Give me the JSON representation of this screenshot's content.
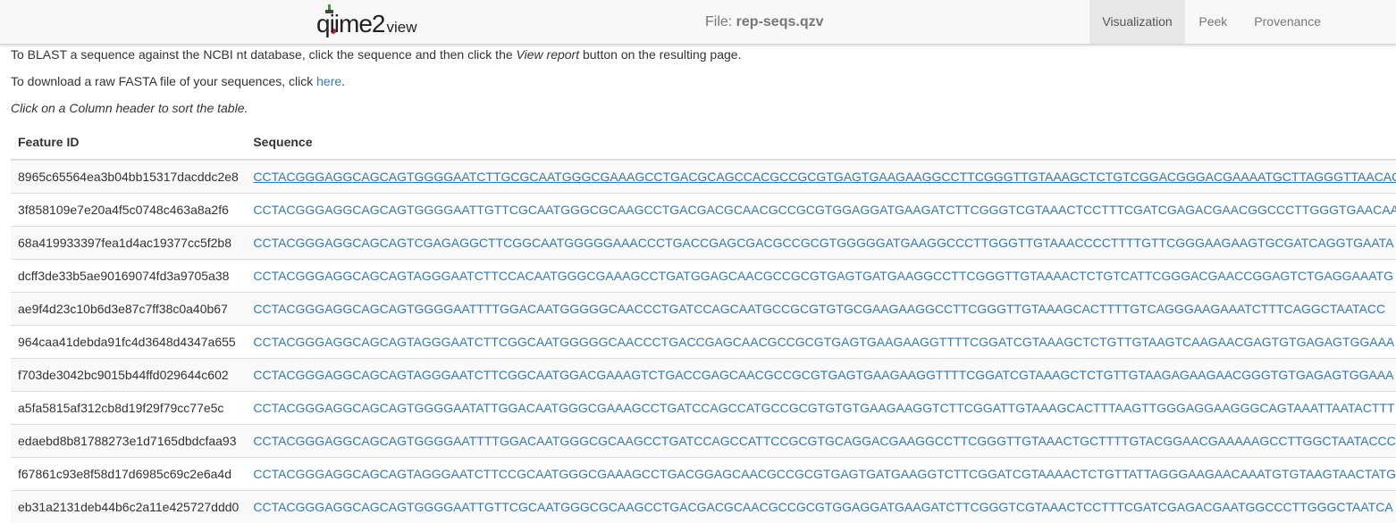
{
  "header": {
    "logo_main": "qiime2",
    "logo_sub": "view",
    "file_prefix": "File: ",
    "file_name": "rep-seqs.qzv",
    "tabs": [
      {
        "label": "Visualization",
        "active": true
      },
      {
        "label": "Peek",
        "active": false
      },
      {
        "label": "Provenance",
        "active": false
      }
    ]
  },
  "intro": {
    "blast_before": "To BLAST a sequence against the NCBI nt database, click the sequence and then click the ",
    "blast_em": "View report",
    "blast_after": " button on the resulting page.",
    "download_before": "To download a raw FASTA file of your sequences, click ",
    "download_link": "here",
    "download_after": ".",
    "sort_hint": "Click on a Column header to sort the table."
  },
  "table": {
    "columns": [
      "Feature ID",
      "Sequence"
    ],
    "rows": [
      {
        "id": "8965c65564ea3b04bb15317dacddc2e8",
        "seq": "CCTACGGGAGGCAGCAGTGGGGAATCTTGCGCAATGGGCGAAAGCCTGACGCAGCCACGCCGCGTGAGTGAAGAAGGCCTTCGGGTTGTAAAGCTCTGTCGGACGGGACGAAAATGCTTAGGGTTAACAC"
      },
      {
        "id": "3f858109e7e20a4f5c0748c463a8a2f6",
        "seq": "CCTACGGGAGGCAGCAGTGGGGAATTGTTCGCAATGGGCGCAAGCCTGACGACGCAACGCCGCGTGGAGGATGAAGATCTTCGGGTCGTAAACTCCTTTCGATCGAGACGAACGGCCCTTGGGTGAACAA"
      },
      {
        "id": "68a419933397fea1d4ac19377cc5f2b8",
        "seq": "CCTACGGGAGGCAGCAGTCGAGAGGCTTCGGCAATGGGGGAAACCCTGACCGAGCGACGCCGCGTGGGGGATGAAGGCCCTTGGGTTGTAAACCCCTTTTGTTCGGGAAGAAGTGCGATCAGGTGAATA"
      },
      {
        "id": "dcff3de33b5ae90169074fd3a9705a38",
        "seq": "CCTACGGGAGGCAGCAGTAGGGAATCTTCCACAATGGGCGAAAGCCTGATGGAGCAACGCCGCGTGAGTGATGAAGGCCTTCGGGTTGTAAAACTCTGTCATTCGGGACGAACCGGAGTCTGAGGAAATG"
      },
      {
        "id": "ae9f4d23c10b6d3e87c7ff38c0a40b67",
        "seq": "CCTACGGGAGGCAGCAGTGGGGAATTTTGGACAATGGGGGCAACCCTGATCCAGCAATGCCGCGTGTGCGAAGAAGGCCTTCGGGTTGTAAAGCACTTTTGTCAGGGAAGAAATCTTTCAGGCTAATACC"
      },
      {
        "id": "964caa41debda91fc4d3648d4347a655",
        "seq": "CCTACGGGAGGCAGCAGTAGGGAATCTTCGGCAATGGGGGCAACCCTGACCGAGCAACGCCGCGTGAGTGAAGAAGGTTTTCGGATCGTAAAGCTCTGTTGTAAGTCAAGAACGAGTGTGAGAGTGGAAA"
      },
      {
        "id": "f703de3042bc9015b44ffd029644c602",
        "seq": "CCTACGGGAGGCAGCAGTAGGGAATCTTCGGCAATGGACGAAAGTCTGACCGAGCAACGCCGCGTGAGTGAAGAAGGTTTTCGGATCGTAAAGCTCTGTTGTAAGAGAAGAACGGGTGTGAGAGTGGAAA"
      },
      {
        "id": "a5fa5815af312cb8d19f29f79cc77e5c",
        "seq": "CCTACGGGAGGCAGCAGTGGGGAATATTGGACAATGGGCGAAAGCCTGATCCAGCCATGCCGCGTGTGTGAAGAAGGTCTTCGGATTGTAAAGCACTTTAAGTTGGGAGGAAGGGCAGTAAATTAATACTTT"
      },
      {
        "id": "edaebd8b81788273e1d7165dbdcfaa93",
        "seq": "CCTACGGGAGGCAGCAGTGGGGAATTTTGGACAATGGGCGCAAGCCTGATCCAGCCATTCCGCGTGCAGGACGAAGGCCTTCGGGTTGTAAACTGCTTTTGTACGGAACGAAAAAGCCTTGGCTAATACCC"
      },
      {
        "id": "f67861c93e8f58d17d6985c69c2e6a4d",
        "seq": "CCTACGGGAGGCAGCAGTAGGGAATCTTCCGCAATGGGCGAAAGCCTGACGGAGCAACGCCGCGTGAGTGATGAAGGTCTTCGGATCGTAAAACTCTGTTATTAGGGAAGAACAAATGTGTAAGTAACTATG"
      },
      {
        "id": "eb31a2131deb44b6c2a11e425727ddd0",
        "seq": "CCTACGGGAGGCAGCAGTGGGGAATTGTTCGCAATGGGCGCAAGCCTGACGACGCAACGCCGCGTGGAGGATGAAGATCTTCGGGTCGTAAACTCCTTTCGATCGAGACGAATGGCCCTTGGGCTAATCA"
      }
    ]
  },
  "colors": {
    "link": "#337ab7",
    "navbar_bg": "#f8f8f8",
    "active_tab_bg": "#e7e7e7",
    "logo_accent_red": "#c0232c",
    "logo_accent_green": "#3a9a3a"
  }
}
